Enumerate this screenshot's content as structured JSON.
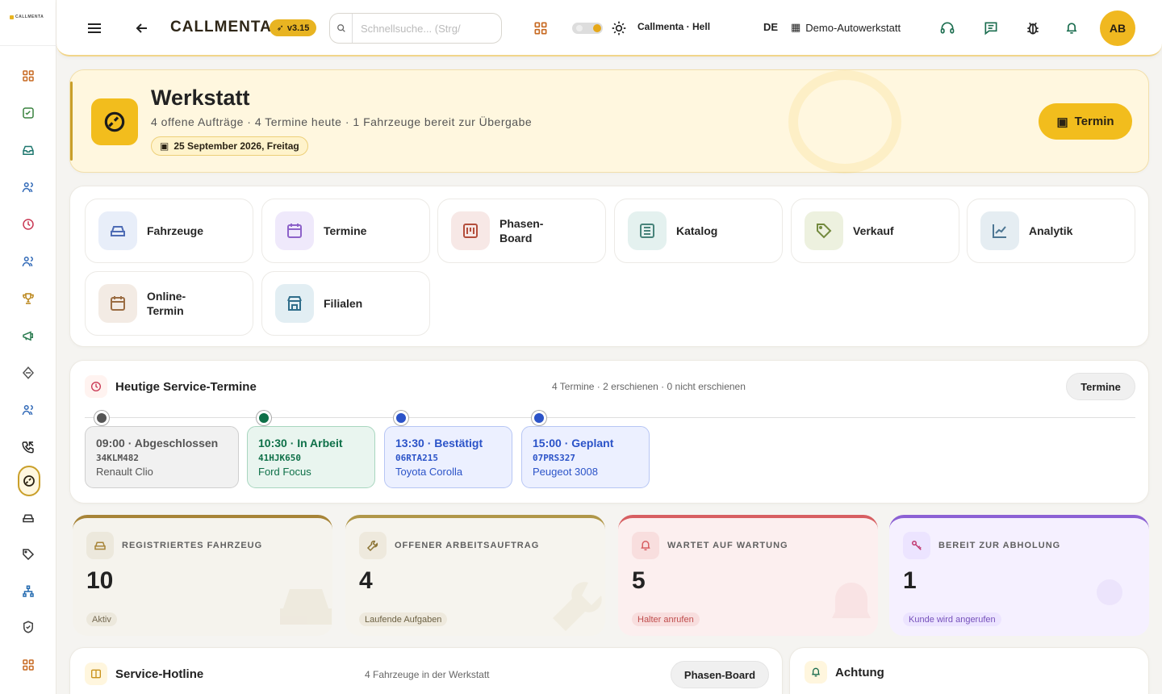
{
  "app": {
    "logo_text": "CALLMENTA",
    "brand": "CALLMENTA",
    "version": "v3.15",
    "search_placeholder": "Schnellsuche... (Strg/",
    "theme_label": "Callmenta · Hell",
    "language": "DE",
    "workshop": "Demo-Autowerkstatt",
    "avatar": "AB",
    "accent": "#f2bd1d"
  },
  "sidebar": {
    "items": [
      {
        "name": "dashboard",
        "icon": "grid"
      },
      {
        "name": "reports",
        "icon": "calendar-check"
      },
      {
        "name": "inbox",
        "icon": "inbox"
      },
      {
        "name": "contacts",
        "icon": "users"
      },
      {
        "name": "history",
        "icon": "clock"
      },
      {
        "name": "customers",
        "icon": "users"
      },
      {
        "name": "awards",
        "icon": "trophy"
      },
      {
        "name": "campaigns",
        "icon": "megaphone"
      },
      {
        "name": "integrations",
        "icon": "diamond"
      },
      {
        "name": "team",
        "icon": "users"
      },
      {
        "name": "calls",
        "icon": "phone"
      },
      {
        "name": "workshop",
        "icon": "wrench",
        "active": true
      },
      {
        "name": "vehicles",
        "icon": "car"
      },
      {
        "name": "sales",
        "icon": "tag"
      },
      {
        "name": "organization",
        "icon": "network"
      },
      {
        "name": "security",
        "icon": "shield"
      },
      {
        "name": "apps",
        "icon": "grid"
      }
    ]
  },
  "hero": {
    "title": "Werkstatt",
    "subtitle": "4 offene Aufträge · 4 Termine heute · 1 Fahrzeuge bereit zur Übergabe",
    "date": "25 September 2026, Freitag",
    "button": "Termin"
  },
  "modules": [
    {
      "label": "Fahrzeuge",
      "icon": "car-icon",
      "color": "#5b76b5",
      "bg": "#e8eef9"
    },
    {
      "label": "Termine",
      "icon": "calendar-icon",
      "color": "#8d62c9",
      "bg": "#efe9fb"
    },
    {
      "label": "Phasen-Board",
      "icon": "board-icon",
      "color": "#b44e3c",
      "bg": "#f7e8e6"
    },
    {
      "label": "Katalog",
      "icon": "list-icon",
      "color": "#47837a",
      "bg": "#e4f1ef"
    },
    {
      "label": "Verkauf",
      "icon": "tag-icon",
      "color": "#738a3e",
      "bg": "#edf1df"
    },
    {
      "label": "Analytik",
      "icon": "chart-icon",
      "color": "#4d7693",
      "bg": "#e5edf2"
    },
    {
      "label": "Online-Termin",
      "icon": "calendar-icon",
      "color": "#9b6d43",
      "bg": "#f3ebe4"
    },
    {
      "label": "Filialen",
      "icon": "store-icon",
      "color": "#2f6d8a",
      "bg": "#e2eef3"
    }
  ],
  "service": {
    "title": "Heutige Service-Termine",
    "meta": "4 Termine · 2 erschienen · 0 nicht erschienen",
    "button": "Termine",
    "appointments": [
      {
        "title": "09:00 · Abgeschlossen",
        "plate": "34KLM482",
        "car": "Renault Clio",
        "status": "done",
        "color": "#555",
        "bg": "#f1f1f1",
        "border": "#cfcfcf"
      },
      {
        "title": "10:30 · In Arbeit",
        "plate": "41HJK650",
        "car": "Ford Focus",
        "status": "progress",
        "color": "#0e7048",
        "bg": "#e9f5ef",
        "border": "#a8d6bf"
      },
      {
        "title": "13:30 · Bestätigt",
        "plate": "06RTA215",
        "car": "Toyota Corolla",
        "status": "confirmed",
        "color": "#2b53c8",
        "bg": "#ecf0ff",
        "border": "#b7c6f4"
      },
      {
        "title": "15:00 · Geplant",
        "plate": "07PRS327",
        "car": "Peugeot 3008",
        "status": "planned",
        "color": "#2b53c8",
        "bg": "#ecf0ff",
        "border": "#b7c6f4"
      }
    ]
  },
  "stats": [
    {
      "label": "REGISTRIERTES FAHRZEUG",
      "value": "10",
      "pill": "Aktiv",
      "color": "#a78438",
      "bg": "#f5f3ed",
      "pill_bg": "#ece8dc",
      "pill_color": "#756a52",
      "icon": "car-icon"
    },
    {
      "label": "OFFENER ARBEITSAUFTRAG",
      "value": "4",
      "pill": "Laufende Aufgaben",
      "color": "#b09749",
      "bg": "#f6f4ee",
      "pill_bg": "#eee9dd",
      "pill_color": "#6d6244",
      "icon": "wrench-icon"
    },
    {
      "label": "WARTET AUF WARTUNG",
      "value": "5",
      "pill": "Halter anrufen",
      "color": "#d75f62",
      "bg": "#fcefef",
      "pill_bg": "#f8dede",
      "pill_color": "#bf4c4c",
      "icon": "bell-icon"
    },
    {
      "label": "BEREIT ZUR ABHOLUNG",
      "value": "1",
      "pill": "Kunde wird angerufen",
      "color": "#8c61d4",
      "bg": "#f5f0ff",
      "pill_bg": "#ece4ff",
      "pill_color": "#7651bb",
      "icon": "key-icon"
    }
  ],
  "bottom": {
    "hotline_title": "Service-Hotline",
    "hotline_meta": "4 Fahrzeuge in der Werkstatt",
    "hotline_button": "Phasen-Board",
    "alert_title": "Achtung"
  }
}
